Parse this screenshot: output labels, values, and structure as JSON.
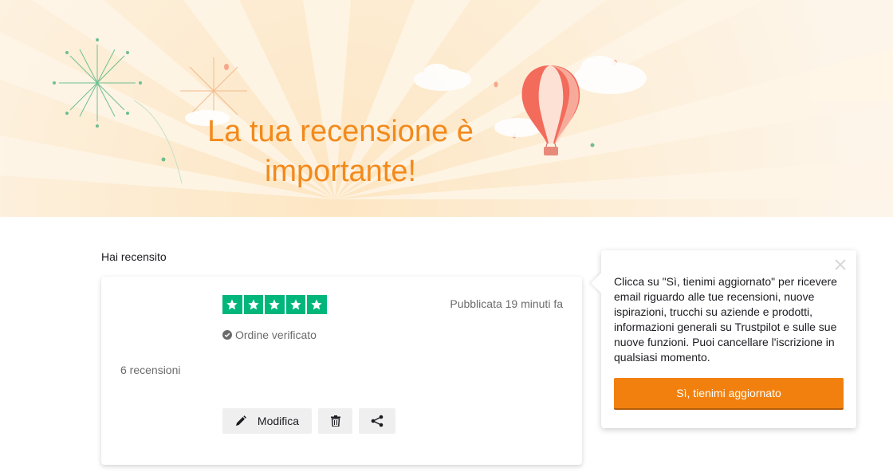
{
  "hero": {
    "title": "La tua recensione è importante!"
  },
  "review": {
    "section_label": "Hai recensito",
    "rating": 5,
    "rating_max": 5,
    "published": "Pubblicata 19 minuti fa",
    "verified": "Ordine verificato",
    "review_count": "6 recensioni",
    "actions": {
      "edit_label": "Modifica",
      "delete_icon": "trash-icon",
      "share_icon": "share-icon"
    },
    "colors": {
      "star_green": "#00b67a"
    }
  },
  "popover": {
    "text": "Clicca su \"Sì, tienimi aggiornato\" per ricevere email riguardo alle tue recensioni, nuove ispirazioni, trucchi su aziende e prodotti, informazioni generali su Trustpilot e sulle sue nuove funzioni. Puoi cancellare l'iscrizione in qualsiasi momento.",
    "cta_label": "Sì, tienimi aggiornato",
    "close_icon": "close-icon",
    "colors": {
      "cta": "#f1800e"
    }
  }
}
